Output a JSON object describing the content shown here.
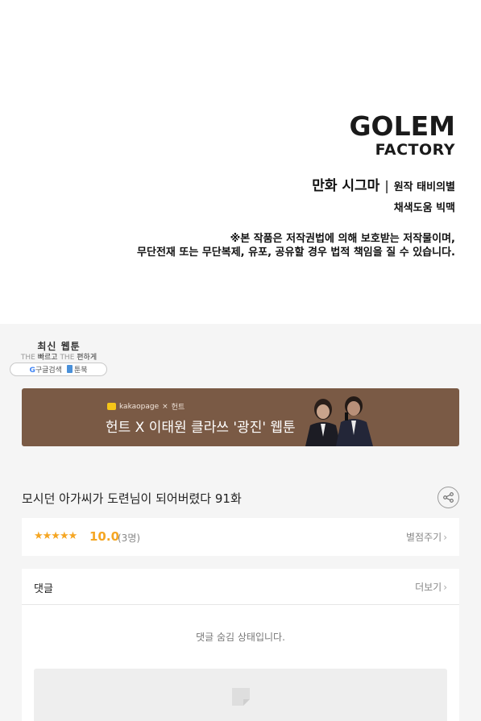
{
  "credits": {
    "logo_line1": "GOLEM",
    "logo_line2": "FACTORY",
    "title_work": "만화 시그마",
    "separator": "|",
    "original": "원작 태비의별",
    "coloring": "채색도움 빅맥",
    "copyright_line1": "※본 작품은 저작권법에 의해 보호받는 저작물이며,",
    "copyright_line2": "무단전재 또는 무단복제, 유포, 공유할 경우 법적 책임을 질 수 있습니다."
  },
  "badge": {
    "title": "최신 웹툰",
    "tagline_the1": "THE",
    "tagline_fast": "빠르고",
    "tagline_the2": "THE",
    "tagline_easy": "편하게",
    "google_g": "G",
    "search_text": "구글검색",
    "site_name": "툰북"
  },
  "banner": {
    "brand": "kakaopage",
    "brand_x": "×",
    "brand_partner": "헌트",
    "title": "헌트 X 이태원 클라쓰 '광진' 웹툰"
  },
  "episode": {
    "title": "모시던 아가씨가 도련님이 되어버렸다 91화"
  },
  "rating": {
    "stars": "★★★★★",
    "score": "10.0",
    "count": "(3명)",
    "rate_label": "별점주기"
  },
  "comments": {
    "label": "댓글",
    "more_label": "더보기",
    "hidden_message": "댓글 숨김 상태입니다."
  },
  "colors": {
    "accent_star": "#f5a623",
    "banner_bg": "#7a5a45"
  }
}
